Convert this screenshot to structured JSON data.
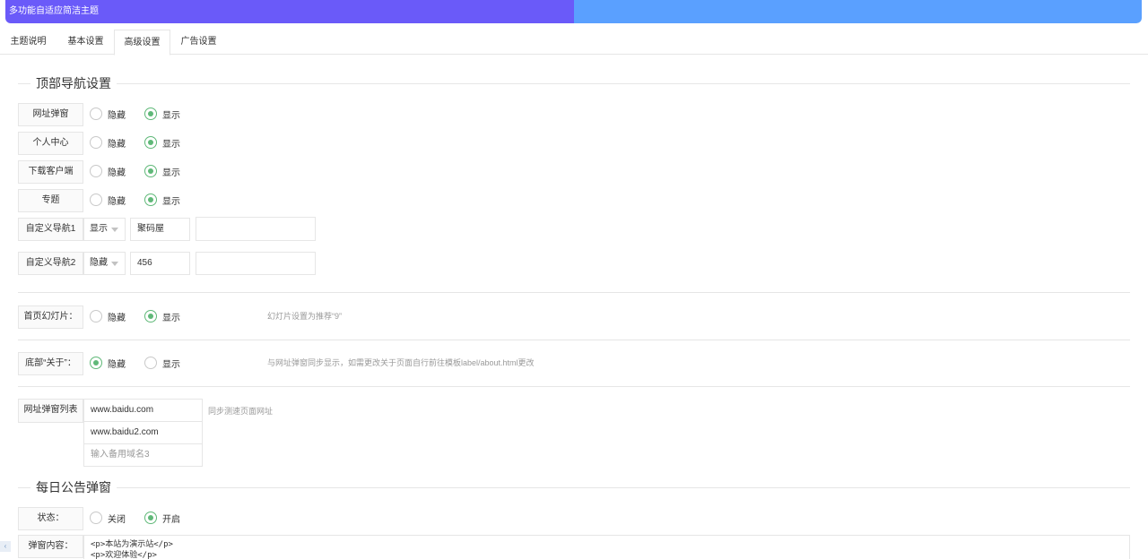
{
  "topbar": {
    "title": "多功能自适应简洁主题",
    "progress": 0.5
  },
  "tabs": [
    {
      "label": "主题说明"
    },
    {
      "label": "基本设置"
    },
    {
      "label": "高级设置"
    },
    {
      "label": "广告设置"
    }
  ],
  "sections": {
    "nav_title": "顶部导航设置",
    "notice_title": "每日公告弹窗"
  },
  "nav_rows": [
    {
      "label": "网址弹窗",
      "opt1": "隐藏",
      "opt2": "显示"
    },
    {
      "label": "个人中心",
      "opt1": "隐藏",
      "opt2": "显示"
    },
    {
      "label": "下载客户端",
      "opt1": "隐藏",
      "opt2": "显示"
    },
    {
      "label": "专题",
      "opt1": "隐藏",
      "opt2": "显示"
    }
  ],
  "custom_nav": [
    {
      "label": "自定义导航1",
      "select": "显示",
      "name": "聚码屋",
      "url": ""
    },
    {
      "label": "自定义导航2",
      "select": "隐藏",
      "name": "456",
      "url": ""
    }
  ],
  "slider": {
    "label": "首页幻灯片：",
    "opt1": "隐藏",
    "opt2": "显示",
    "hint": "幻灯片设置为推荐“9”"
  },
  "about": {
    "label": "底部“关于”：",
    "opt1": "隐藏",
    "opt2": "显示",
    "hint": "与网址弹窗同步显示，如需更改关于页面自行前往模板label/about.html更改"
  },
  "url_list": {
    "label": "网址弹窗列表",
    "items": [
      "www.baidu.com",
      "www.baidu2.com"
    ],
    "placeholder3": "输入备用域名3",
    "hint": "同步测速页面网址"
  },
  "notice": {
    "status_label": "状态：",
    "opt1": "关闭",
    "opt2": "开启",
    "content_label": "弹窗内容：",
    "content_line1": "<p>本站为演示站</p>",
    "content_line2": "<p>欢迎体验</p>"
  },
  "colors": {
    "accent": "#5fb878",
    "progress": "#6a5af9",
    "bar": "#5aa0ff"
  }
}
